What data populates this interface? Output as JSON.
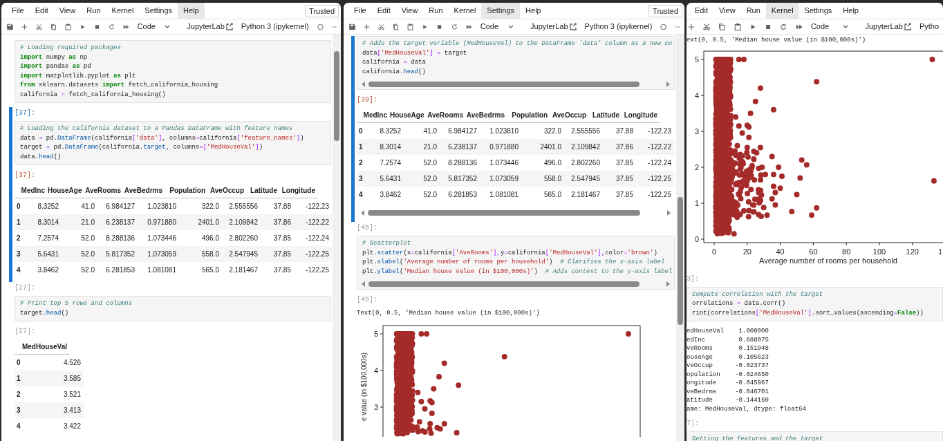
{
  "windows": [
    {
      "menu": [
        {
          "label": "File",
          "selected": false
        },
        {
          "label": "Edit",
          "selected": false
        },
        {
          "label": "View",
          "selected": false
        },
        {
          "label": "Run",
          "selected": false
        },
        {
          "label": "Kernel",
          "selected": false
        },
        {
          "label": "Settings",
          "selected": false
        },
        {
          "label": "Help",
          "selected": true
        }
      ],
      "trusted": "Trusted",
      "toolbar": {
        "cut_left": false,
        "cell_type": "Code",
        "jupyterlab": "JupyterLab",
        "kernel": "Python 3 (ipykernel)",
        "kernel_indicator": true
      },
      "cells": [
        {
          "kind": "code",
          "active": false,
          "h_scrollbar": false,
          "lines": [
            [
              {
                "kind": "comment",
                "text": "# Loading required packages"
              }
            ],
            [
              {
                "kind": "keyword",
                "text": "import"
              },
              {
                "kind": "name",
                "text": " numpy "
              },
              {
                "kind": "keyword",
                "text": "as"
              },
              {
                "kind": "name",
                "text": " np"
              }
            ],
            [
              {
                "kind": "keyword",
                "text": "import"
              },
              {
                "kind": "name",
                "text": " pandas "
              },
              {
                "kind": "keyword",
                "text": "as"
              },
              {
                "kind": "name",
                "text": " pd"
              }
            ],
            [
              {
                "kind": "keyword",
                "text": "import"
              },
              {
                "kind": "name",
                "text": " matplotlib.pyplot "
              },
              {
                "kind": "keyword",
                "text": "as"
              },
              {
                "kind": "name",
                "text": " plt"
              }
            ],
            [
              {
                "kind": "keyword",
                "text": "from"
              },
              {
                "kind": "name",
                "text": " sklearn.datasets "
              },
              {
                "kind": "keyword",
                "text": "import"
              },
              {
                "kind": "name",
                "text": " fetch_california_housing"
              }
            ],
            [
              {
                "kind": "name",
                "text": "california "
              },
              {
                "kind": "operator",
                "text": "="
              },
              {
                "kind": "name",
                "text": " fetch_california_housing()"
              }
            ]
          ]
        },
        {
          "kind": "code",
          "prompt": "[37]:",
          "active": true,
          "h_scrollbar": false,
          "lines": [
            [
              {
                "kind": "comment",
                "text": "# Loading the california dataset to a Pandas DataFrame with feature names"
              }
            ],
            [
              {
                "kind": "name",
                "text": "data "
              },
              {
                "kind": "operator",
                "text": "="
              },
              {
                "kind": "name",
                "text": " pd."
              },
              {
                "kind": "attribute",
                "text": "DataFrame"
              },
              {
                "kind": "name",
                "text": "(california"
              },
              {
                "kind": "operator",
                "text": "["
              },
              {
                "kind": "string",
                "text": "'data'"
              },
              {
                "kind": "operator",
                "text": "]"
              },
              {
                "kind": "name",
                "text": ", columns"
              },
              {
                "kind": "operator",
                "text": "="
              },
              {
                "kind": "name",
                "text": "california"
              },
              {
                "kind": "operator",
                "text": "["
              },
              {
                "kind": "string",
                "text": "'feature_names'"
              },
              {
                "kind": "operator",
                "text": "]"
              },
              {
                "kind": "name",
                "text": ")"
              }
            ],
            [
              {
                "kind": "name",
                "text": "target "
              },
              {
                "kind": "operator",
                "text": "="
              },
              {
                "kind": "name",
                "text": " pd."
              },
              {
                "kind": "attribute",
                "text": "DataFrame"
              },
              {
                "kind": "name",
                "text": "(california."
              },
              {
                "kind": "attribute",
                "text": "target"
              },
              {
                "kind": "name",
                "text": ", columns"
              },
              {
                "kind": "operator",
                "text": "=["
              },
              {
                "kind": "string",
                "text": "'MedHouseVal'"
              },
              {
                "kind": "operator",
                "text": "]"
              },
              {
                "kind": "name",
                "text": ")"
              }
            ],
            [
              {
                "kind": "name",
                "text": "data."
              },
              {
                "kind": "attribute",
                "text": "head"
              },
              {
                "kind": "name",
                "text": "()"
              }
            ]
          ]
        },
        {
          "kind": "table",
          "prompt": "[37]:",
          "active": true,
          "h_scrollbar": false,
          "columns": [
            "MedInc",
            "HouseAge",
            "AveRooms",
            "AveBedrms",
            "Population",
            "AveOccup",
            "Latitude",
            "Longitude"
          ],
          "rows": [
            {
              "index": "0",
              "cells": [
                "8.3252",
                "41.0",
                "6.984127",
                "1.023810",
                "322.0",
                "2.555556",
                "37.88",
                "-122.23"
              ]
            },
            {
              "index": "1",
              "cells": [
                "8.3014",
                "21.0",
                "6.238137",
                "0.971880",
                "2401.0",
                "2.109842",
                "37.86",
                "-122.22"
              ]
            },
            {
              "index": "2",
              "cells": [
                "7.2574",
                "52.0",
                "8.288136",
                "1.073446",
                "496.0",
                "2.802260",
                "37.85",
                "-122.24"
              ]
            },
            {
              "index": "3",
              "cells": [
                "5.6431",
                "52.0",
                "5.817352",
                "1.073059",
                "558.0",
                "2.547945",
                "37.85",
                "-122.25"
              ]
            },
            {
              "index": "4",
              "cells": [
                "3.8462",
                "52.0",
                "6.281853",
                "1.081081",
                "565.0",
                "2.181467",
                "37.85",
                "-122.25"
              ]
            }
          ]
        },
        {
          "kind": "code",
          "prompt": "[27]:",
          "active": false,
          "h_scrollbar": false,
          "lines": [
            [
              {
                "kind": "comment",
                "text": "# Print top 5 rows and columns"
              }
            ],
            [
              {
                "kind": "name",
                "text": "target."
              },
              {
                "kind": "attribute",
                "text": "head"
              },
              {
                "kind": "name",
                "text": "()"
              }
            ]
          ]
        },
        {
          "kind": "table",
          "prompt": "[27]:",
          "active": false,
          "h_scrollbar": false,
          "columns": [
            "MedHouseVal"
          ],
          "rows": [
            {
              "index": "0",
              "cells": [
                "4.526"
              ]
            },
            {
              "index": "1",
              "cells": [
                "3.585"
              ]
            },
            {
              "index": "2",
              "cells": [
                "3.521"
              ]
            },
            {
              "index": "3",
              "cells": [
                "3.413"
              ]
            },
            {
              "index": "4",
              "cells": [
                "3.422"
              ]
            }
          ]
        }
      ]
    },
    {
      "menu": [
        {
          "label": "File",
          "selected": false
        },
        {
          "label": "Edit",
          "selected": false
        },
        {
          "label": "View",
          "selected": false
        },
        {
          "label": "Run",
          "selected": false
        },
        {
          "label": "Kernel",
          "selected": false
        },
        {
          "label": "Settings",
          "selected": true
        },
        {
          "label": "Help",
          "selected": false
        }
      ],
      "trusted": "Trusted",
      "toolbar": {
        "cut_left": false,
        "cell_type": "Code",
        "jupyterlab": "JupyterLab",
        "kernel": "Python 3 (ipykernel)",
        "kernel_indicator": true
      },
      "cells": [
        {
          "kind": "code",
          "active": true,
          "h_scrollbar": true,
          "lines": [
            [
              {
                "kind": "comment",
                "text": "# Adds the target variable (MedHouseVal) to the DataFrame 'data' column as a new co"
              }
            ],
            [
              {
                "kind": "name",
                "text": "data"
              },
              {
                "kind": "operator",
                "text": "["
              },
              {
                "kind": "string",
                "text": "'MedHouseVal'"
              },
              {
                "kind": "operator",
                "text": "] ="
              },
              {
                "kind": "name",
                "text": " target"
              }
            ],
            [
              {
                "kind": "name",
                "text": "california "
              },
              {
                "kind": "operator",
                "text": "="
              },
              {
                "kind": "name",
                "text": " data"
              }
            ],
            [
              {
                "kind": "name",
                "text": "california."
              },
              {
                "kind": "attribute",
                "text": "head"
              },
              {
                "kind": "name",
                "text": "()"
              }
            ]
          ]
        },
        {
          "kind": "table",
          "prompt": "[39]:",
          "active": true,
          "h_scrollbar": true,
          "columns": [
            "MedInc",
            "HouseAge",
            "AveRooms",
            "AveBedrms",
            "Population",
            "AveOccup",
            "Latitude",
            "Longitude"
          ],
          "rows": [
            {
              "index": "0",
              "cells": [
                "8.3252",
                "41.0",
                "6.984127",
                "1.023810",
                "322.0",
                "2.555556",
                "37.88",
                "-122.23"
              ]
            },
            {
              "index": "1",
              "cells": [
                "8.3014",
                "21.0",
                "6.238137",
                "0.971880",
                "2401.0",
                "2.109842",
                "37.86",
                "-122.22"
              ]
            },
            {
              "index": "2",
              "cells": [
                "7.2574",
                "52.0",
                "8.288136",
                "1.073446",
                "496.0",
                "2.802260",
                "37.85",
                "-122.24"
              ]
            },
            {
              "index": "3",
              "cells": [
                "5.6431",
                "52.0",
                "5.817352",
                "1.073059",
                "558.0",
                "2.547945",
                "37.85",
                "-122.25"
              ]
            },
            {
              "index": "4",
              "cells": [
                "3.8462",
                "52.0",
                "6.281853",
                "1.081081",
                "565.0",
                "2.181467",
                "37.85",
                "-122.25"
              ]
            }
          ]
        },
        {
          "kind": "code",
          "prompt": "[45]:",
          "active": false,
          "h_scrollbar": true,
          "lines": [
            [
              {
                "kind": "comment",
                "text": "# Scatterplot"
              }
            ],
            [
              {
                "kind": "name",
                "text": "plt."
              },
              {
                "kind": "attribute",
                "text": "scatter"
              },
              {
                "kind": "name",
                "text": "(x"
              },
              {
                "kind": "operator",
                "text": "="
              },
              {
                "kind": "name",
                "text": "california"
              },
              {
                "kind": "operator",
                "text": "["
              },
              {
                "kind": "string",
                "text": "'AveRooms'"
              },
              {
                "kind": "operator",
                "text": "],"
              },
              {
                "kind": "name",
                "text": "y"
              },
              {
                "kind": "operator",
                "text": "="
              },
              {
                "kind": "name",
                "text": "california"
              },
              {
                "kind": "operator",
                "text": "["
              },
              {
                "kind": "string",
                "text": "'MedHouseVal'"
              },
              {
                "kind": "operator",
                "text": "],"
              },
              {
                "kind": "name",
                "text": "color"
              },
              {
                "kind": "operator",
                "text": "="
              },
              {
                "kind": "string",
                "text": "'brown'"
              },
              {
                "kind": "name",
                "text": ")"
              }
            ],
            [
              {
                "kind": "name",
                "text": "plt."
              },
              {
                "kind": "attribute",
                "text": "xlabel"
              },
              {
                "kind": "name",
                "text": "("
              },
              {
                "kind": "string",
                "text": "'Average number of rooms per household'"
              },
              {
                "kind": "name",
                "text": ")"
              },
              {
                "kind": "comment",
                "text": "  # Clarifies the x-axis label"
              }
            ],
            [
              {
                "kind": "name",
                "text": "plt."
              },
              {
                "kind": "attribute",
                "text": "ylabel"
              },
              {
                "kind": "name",
                "text": "("
              },
              {
                "kind": "string",
                "text": "'Median house value (in $100,000s)'"
              },
              {
                "kind": "name",
                "text": ")"
              },
              {
                "kind": "comment",
                "text": "  # Adds context to the y-axis label"
              }
            ]
          ]
        },
        {
          "kind": "text",
          "prompt": "[45]:",
          "active": false,
          "text": "Text(0, 0.5, 'Median house value (in $100,000s)')"
        },
        {
          "kind": "chart",
          "active": false,
          "ylabel": "e value (in $100,000s)",
          "y_tick_labels": [
            "5",
            "4",
            "3"
          ]
        }
      ]
    },
    {
      "menu": [
        {
          "label": "Edit",
          "selected": false
        },
        {
          "label": "View",
          "selected": false
        },
        {
          "label": "Run",
          "selected": false
        },
        {
          "label": "Kernel",
          "selected": true
        },
        {
          "label": "Settings",
          "selected": false
        },
        {
          "label": "Help",
          "selected": false
        }
      ],
      "toolbar": {
        "cut_left": true,
        "cell_type": "Code",
        "jupyterlab": "JupyterLab",
        "kernel": "Pytho",
        "kernel_indicator": false
      },
      "cells": [
        {
          "kind": "text",
          "active": false,
          "text": "ext(0, 0.5, 'Median house value (in $100,000s)')"
        },
        {
          "kind": "chart",
          "active": false,
          "xlabel": "Average number of rooms per household",
          "y_tick_labels": [
            "5",
            "4",
            "3",
            "2",
            "1",
            "0"
          ],
          "x_tick_labels": [
            "0",
            "20",
            "40",
            "60",
            "80",
            "100",
            "120",
            "1"
          ]
        },
        {
          "kind": "code",
          "prompt": "3]:",
          "active": false,
          "h_scrollbar": false,
          "lines": [
            [
              {
                "kind": "comment",
                "text": "Compute correlation with the target"
              }
            ],
            [
              {
                "kind": "name",
                "text": "orrelations "
              },
              {
                "kind": "operator",
                "text": "="
              },
              {
                "kind": "name",
                "text": " data.corr()"
              }
            ],
            [
              {
                "kind": "name",
                "text": "rint(correlations"
              },
              {
                "kind": "operator",
                "text": "["
              },
              {
                "kind": "string",
                "text": "'MedHouseVal'"
              },
              {
                "kind": "operator",
                "text": "]"
              },
              {
                "kind": "name",
                "text": ".sort_values(ascending"
              },
              {
                "kind": "operator",
                "text": "="
              },
              {
                "kind": "builtin",
                "text": "False"
              },
              {
                "kind": "name",
                "text": "))"
              }
            ]
          ]
        },
        {
          "kind": "text",
          "active": false,
          "text": "edHouseVal    1.000000\nedInc         0.688075\nveRooms       0.151948\nouseAge       0.105623\nveOccup      -0.023737\nopulation    -0.024650\nongitude     -0.045967\nveBedrms     -0.046701\natitude      -0.144160\name: MedHouseVal, dtype: float64"
        },
        {
          "kind": "code",
          "prompt": "7]:",
          "active": false,
          "h_scrollbar": false,
          "lines": [
            [
              {
                "kind": "comment",
                "text": "Getting the features and the target"
              }
            ]
          ]
        }
      ]
    }
  ]
}
